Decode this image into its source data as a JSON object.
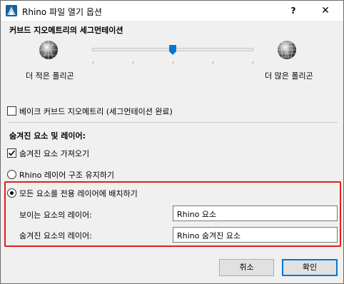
{
  "window": {
    "title": "Rhino 파일 열기 옵션",
    "help_label": "?",
    "close_label": "✕",
    "app_icon": "rhino-app-icon"
  },
  "segmentation": {
    "heading": "커브드 지오메트리의 세그먼테이션",
    "fewer_label": "더 적은 폴리곤",
    "more_label": "더 많은 폴리곤",
    "slider_value_fraction": 0.5
  },
  "bake": {
    "label": "베이크 커브드 지오메트리 (세그먼테이션 완료)",
    "checked": false
  },
  "hidden": {
    "heading": "숨겨진 요소 및 레이어:",
    "import_label": "숨겨진 요소 가져오기",
    "import_checked": true
  },
  "layers": {
    "keep_structure_label": "Rhino 레이어 구조 유지하기",
    "dedicated_label": "모든 요소를 전용 레이어에 배치하기",
    "selected": "dedicated",
    "visible_label": "보이는 요소의 레이어:",
    "visible_value": "Rhino 요소",
    "hidden_label": "숨겨진 요소의 레이어:",
    "hidden_value": "Rhino 숨겨진 요소"
  },
  "buttons": {
    "cancel": "취소",
    "ok": "확인"
  },
  "colors": {
    "highlight": "#e0201a",
    "accent": "#0078d7"
  }
}
